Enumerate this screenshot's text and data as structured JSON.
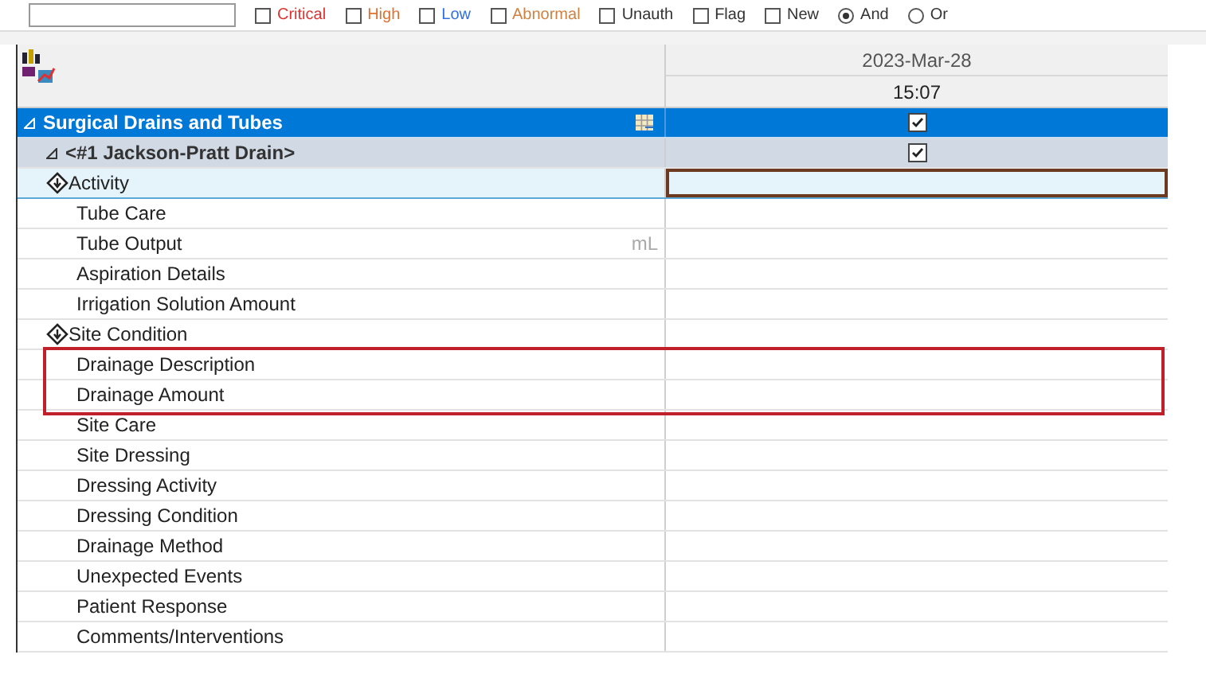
{
  "filters": [
    {
      "label": "Critical",
      "color": "#e03030",
      "checked": false
    },
    {
      "label": "High",
      "color": "#e07030",
      "checked": false
    },
    {
      "label": "Low",
      "color": "#3070e0",
      "checked": false
    },
    {
      "label": "Abnormal",
      "color": "#d08040",
      "checked": false
    },
    {
      "label": "Unauth",
      "color": "#333333",
      "checked": false
    },
    {
      "label": "Flag",
      "color": "#333333",
      "checked": false
    },
    {
      "label": "New",
      "color": "#333333",
      "checked": false
    }
  ],
  "logic": [
    {
      "label": "And",
      "selected": true
    },
    {
      "label": "Or",
      "selected": false
    }
  ],
  "header": {
    "date": "2023-Mar-28",
    "time": "15:07"
  },
  "section": {
    "label": "Surgical Drains and Tubes",
    "checked": true
  },
  "group": {
    "label": "<#1 Jackson-Pratt Drain>",
    "checked": true
  },
  "rows": [
    {
      "label": "Activity",
      "kind": "parent",
      "selected": true,
      "highlighted": false
    },
    {
      "label": "Tube Care",
      "kind": "item",
      "selected": false,
      "highlighted": false
    },
    {
      "label": "Tube Output",
      "kind": "item",
      "unit": "mL",
      "selected": false,
      "highlighted": false
    },
    {
      "label": "Aspiration Details",
      "kind": "item",
      "selected": false,
      "highlighted": false
    },
    {
      "label": "Irrigation Solution Amount",
      "kind": "item",
      "selected": false,
      "highlighted": false
    },
    {
      "label": "Site Condition",
      "kind": "parent",
      "selected": false,
      "highlighted": false
    },
    {
      "label": "Drainage Description",
      "kind": "item",
      "selected": false,
      "highlighted": true
    },
    {
      "label": "Drainage Amount",
      "kind": "item",
      "selected": false,
      "highlighted": true
    },
    {
      "label": "Site Care",
      "kind": "item",
      "selected": false,
      "highlighted": false
    },
    {
      "label": "Site Dressing",
      "kind": "item",
      "selected": false,
      "highlighted": false
    },
    {
      "label": "Dressing Activity",
      "kind": "item",
      "selected": false,
      "highlighted": false
    },
    {
      "label": "Dressing Condition",
      "kind": "item",
      "selected": false,
      "highlighted": false
    },
    {
      "label": "Drainage Method",
      "kind": "item",
      "selected": false,
      "highlighted": false
    },
    {
      "label": "Unexpected Events",
      "kind": "item",
      "selected": false,
      "highlighted": false
    },
    {
      "label": "Patient Response",
      "kind": "item",
      "selected": false,
      "highlighted": false
    },
    {
      "label": "Comments/Interventions",
      "kind": "item",
      "selected": false,
      "highlighted": false
    }
  ]
}
